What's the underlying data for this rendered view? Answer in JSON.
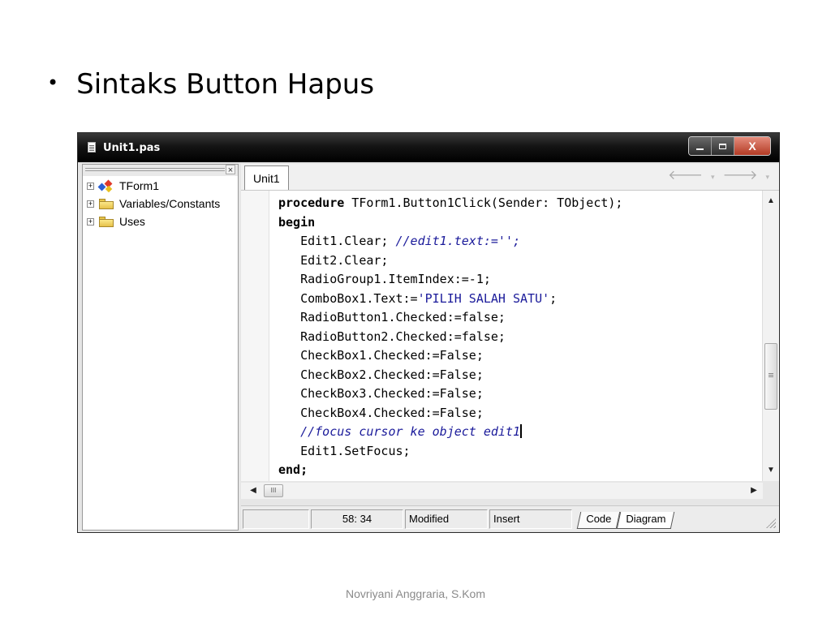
{
  "slide": {
    "bullet": "•",
    "title": "Sintaks Button Hapus",
    "footer": "Novriyani Anggraria, S.Kom"
  },
  "window": {
    "title": "Unit1.pas",
    "icon": "document-icon",
    "controls": {
      "minimize": "minimize-icon",
      "maximize": "maximize-icon",
      "close": "X"
    }
  },
  "tree": {
    "close_label": "×",
    "items": [
      {
        "label": "TForm1",
        "icon": "class-icon"
      },
      {
        "label": "Variables/Constants",
        "icon": "folder-icon"
      },
      {
        "label": "Uses",
        "icon": "folder-icon"
      }
    ]
  },
  "editor": {
    "tab_label": "Unit1",
    "nav": {
      "back": "🡐",
      "forward": "🡒",
      "dropdown": "▾"
    },
    "code_lines": [
      "procedure TForm1.Button1Click(Sender: TObject);",
      "begin",
      "   Edit1.Clear; //edit1.text:='';",
      "   Edit2.Clear;",
      "   RadioGroup1.ItemIndex:=-1;",
      "   ComboBox1.Text:='PILIH SALAH SATU';",
      "   RadioButton1.Checked:=false;",
      "   RadioButton2.Checked:=false;",
      "   CheckBox1.Checked:=False;",
      "   CheckBox2.Checked:=False;",
      "   CheckBox3.Checked:=False;",
      "   CheckBox4.Checked:=False;",
      "   //focus cursor ke object edit1",
      "   Edit1.SetFocus;",
      "end;"
    ],
    "scroll": {
      "up": "▲",
      "down": "▼",
      "left": "◀",
      "right": "▶",
      "hthumb": "III"
    }
  },
  "status": {
    "position": "58: 34",
    "state": "Modified",
    "mode": "Insert",
    "view_tabs": [
      "Code",
      "Diagram"
    ]
  }
}
